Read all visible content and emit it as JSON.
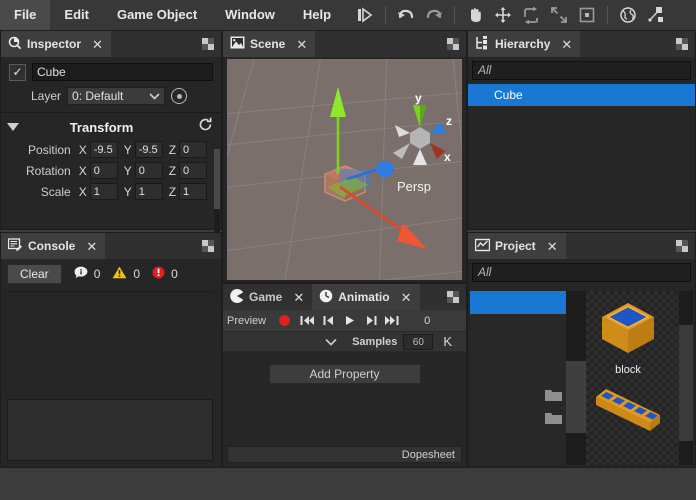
{
  "menu": {
    "items": [
      {
        "label": "File",
        "name": "menu-file"
      },
      {
        "label": "Edit",
        "name": "menu-edit"
      },
      {
        "label": "Game Object",
        "name": "menu-game-object"
      },
      {
        "label": "Window",
        "name": "menu-window"
      },
      {
        "label": "Help",
        "name": "menu-help"
      }
    ]
  },
  "toolbar": {
    "icons": [
      "step-icon",
      "undo-icon",
      "redo-icon",
      "hand-tool-icon",
      "move-tool-icon",
      "rotate-tool-icon",
      "scale-tool-icon",
      "rect-tool-icon",
      "global-pivot-icon",
      "pivot-mode-icon"
    ]
  },
  "inspector": {
    "tab": "Inspector",
    "tab_icon": "inspector-icon",
    "close": "✕",
    "enabled": true,
    "check_glyph": "✓",
    "object_name": "Cube",
    "layer_label": "Layer",
    "layer_value": "0: Default",
    "transform": {
      "title": "Transform",
      "reset_icon": "reset-icon",
      "rows": [
        {
          "label": "Position",
          "x": "-9.5",
          "y": "-9.5",
          "z": "0"
        },
        {
          "label": "Rotation",
          "x": "0",
          "y": "0",
          "z": "0"
        },
        {
          "label": "Scale",
          "x": "1",
          "y": "1",
          "z": "1"
        }
      ],
      "axes": [
        "X",
        "Y",
        "Z"
      ]
    }
  },
  "console": {
    "tab": "Console",
    "tab_icon": "console-icon",
    "close": "✕",
    "clear_label": "Clear",
    "info_count": "0",
    "warning_count": "0",
    "error_count": "0"
  },
  "scene": {
    "tab": "Scene",
    "tab_icon": "scene-icon",
    "close": "✕",
    "projection_label": "Persp",
    "axis_labels": {
      "x": "x",
      "y": "y",
      "z": "z"
    },
    "colors": {
      "x_axis": "#e2472a",
      "y_axis": "#7ed321",
      "z_axis": "#2a6fd4",
      "background": "#7a6f6a"
    }
  },
  "game_anim": {
    "game_tab": "Game",
    "game_icon": "game-icon",
    "anim_tab": "Animatio",
    "anim_icon": "clock-icon",
    "close": "✕",
    "preview_label": "Preview",
    "record_icon": "record-icon",
    "controls": [
      "skip-start-icon",
      "prev-frame-icon",
      "play-icon",
      "next-frame-icon",
      "skip-end-icon"
    ],
    "frame_value": "0",
    "samples_label": "Samples",
    "samples_value": "60",
    "key_label": "K",
    "add_property_label": "Add Property",
    "dopesheet_label": "Dopesheet"
  },
  "hierarchy": {
    "tab": "Hierarchy",
    "tab_icon": "hierarchy-icon",
    "close": "✕",
    "search_placeholder": "All",
    "items": [
      {
        "label": "Cube",
        "selected": true
      }
    ]
  },
  "project": {
    "tab": "Project",
    "tab_icon": "project-icon",
    "close": "✕",
    "search_placeholder": "All",
    "tree_rows": [
      {
        "selected": true,
        "folder": false
      },
      {
        "selected": false,
        "folder": false
      },
      {
        "selected": false,
        "folder": false
      },
      {
        "selected": false,
        "folder": false
      },
      {
        "selected": false,
        "folder": true
      },
      {
        "selected": false,
        "folder": true
      }
    ],
    "assets": [
      {
        "label": "block",
        "icon": "cube-asset-icon"
      },
      {
        "label": "",
        "icon": "brick-asset-icon"
      }
    ]
  },
  "colors": {
    "accent": "#1978d4",
    "panel_bg": "#262626",
    "chrome_bg": "#3c3c3c",
    "tab_active": "#3e3e3e",
    "asset_orange": "#e09820",
    "asset_blue": "#1f55c4",
    "error_red": "#e02020",
    "warning_yellow": "#f2c40c"
  }
}
